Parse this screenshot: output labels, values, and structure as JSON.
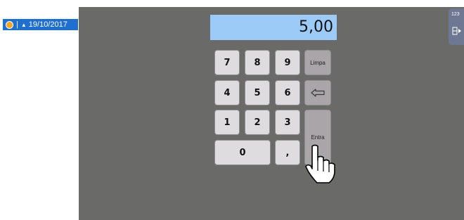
{
  "status": {
    "separator": "|",
    "arrow": "▲",
    "date": "19/10/2017"
  },
  "keypad": {
    "display": "5,00",
    "keys": {
      "k7": "7",
      "k8": "8",
      "k9": "9",
      "k4": "4",
      "k5": "5",
      "k6": "6",
      "k1": "1",
      "k2": "2",
      "k3": "3",
      "k0": "0",
      "comma": ",",
      "clear": "Limpa",
      "enter": "Entra"
    }
  },
  "side_tab": {
    "label": "123",
    "icon": "dock-panel-icon"
  },
  "icons": {
    "status": "status-dot-icon",
    "backspace": "backspace-arrow-icon",
    "cursor": "hand-pointer-cursor"
  },
  "colors": {
    "panel": "#6a6b68",
    "display": "#9dcbf8",
    "status_bar": "#1f6fd1",
    "status_dot": "#f5a623",
    "key": "#dfdcdf",
    "key_function": "#a9a5a9"
  }
}
